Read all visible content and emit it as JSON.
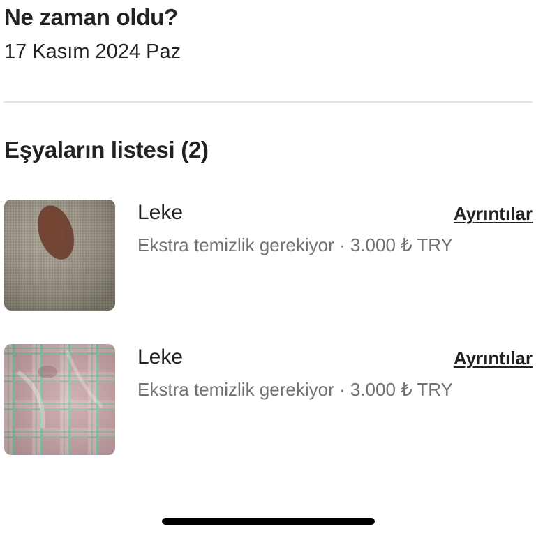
{
  "when": {
    "title": "Ne zaman oldu?",
    "date": "17 Kasım 2024 Paz"
  },
  "items_section": {
    "title": "Eşyaların listesi (2)",
    "items": [
      {
        "name": "Leke",
        "description": "Ekstra temizlik gerekiyor · 3.000 ₺ TRY",
        "details_label": "Ayrıntılar",
        "photo": "beige fabric with brown oval stain"
      },
      {
        "name": "Leke",
        "description": "Ekstra temizlik gerekiyor · 3.000 ₺ TRY",
        "details_label": "Ayrıntılar",
        "photo": "pink and green plaid fabric with stain"
      }
    ]
  },
  "colors": {
    "text_primary": "#222222",
    "text_secondary": "#717171",
    "divider": "#e3e3e3"
  }
}
